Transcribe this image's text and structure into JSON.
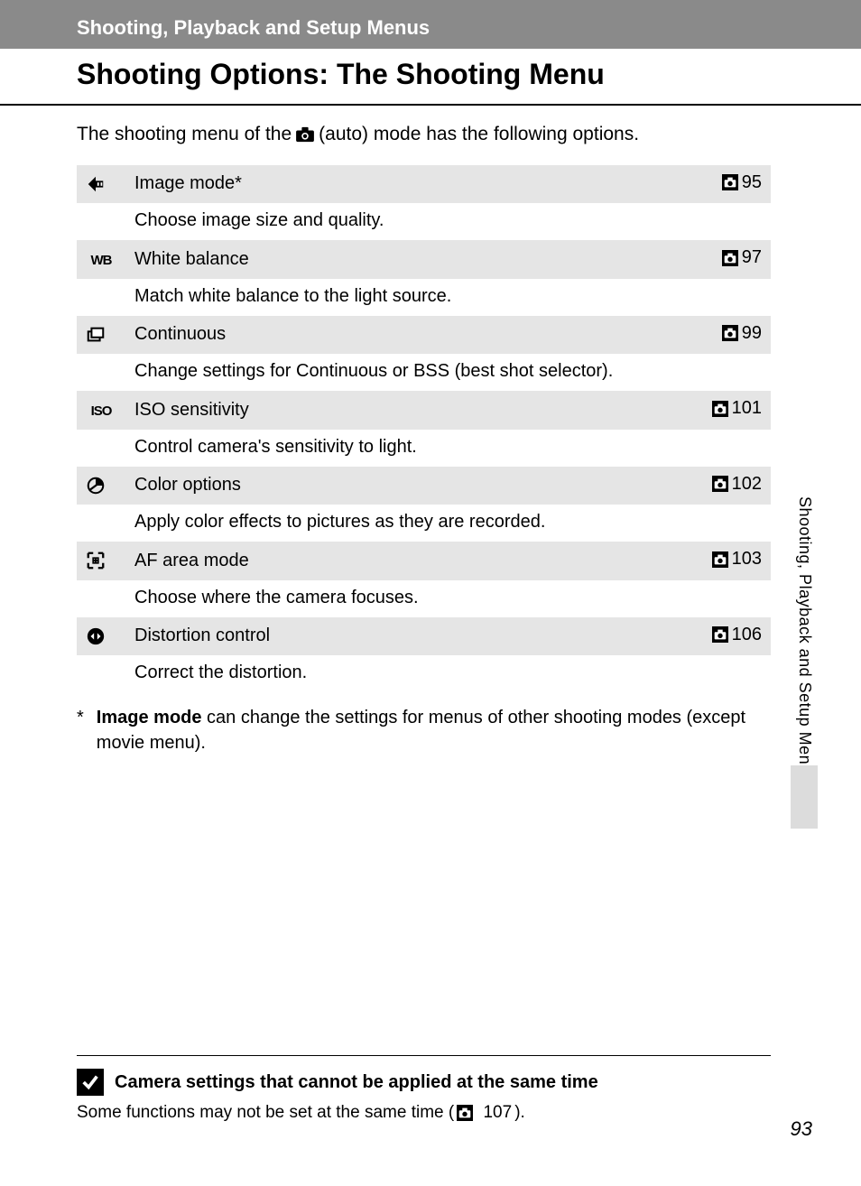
{
  "header": {
    "breadcrumb": "Shooting, Playback and Setup Menus",
    "title": "Shooting Options: The Shooting Menu"
  },
  "intro": {
    "before": "The shooting menu of the ",
    "after": " (auto) mode has the following options."
  },
  "options": [
    {
      "icon": "image-mode-icon",
      "label": "Image mode*",
      "page": "95",
      "desc": "Choose image size and quality."
    },
    {
      "icon": "wb-icon",
      "label": "White balance",
      "page": "97",
      "desc": "Match white balance to the light source."
    },
    {
      "icon": "continuous-icon",
      "label": "Continuous",
      "page": "99",
      "desc": "Change settings for Continuous or BSS (best shot selector)."
    },
    {
      "icon": "iso-icon",
      "label": "ISO sensitivity",
      "page": "101",
      "desc": "Control camera's sensitivity to light."
    },
    {
      "icon": "color-icon",
      "label": "Color options",
      "page": "102",
      "desc": "Apply color effects to pictures as they are recorded."
    },
    {
      "icon": "af-area-icon",
      "label": "AF area mode",
      "page": "103",
      "desc": "Choose where the camera focuses."
    },
    {
      "icon": "distortion-icon",
      "label": "Distortion control",
      "page": "106",
      "desc": "Correct the distortion."
    }
  ],
  "footnote": {
    "marker": "*",
    "bold": "Image mode",
    "rest": " can change the settings for menus of other shooting modes (except movie menu)."
  },
  "side_tab": "Shooting, Playback and Setup Menus",
  "note": {
    "title": "Camera settings that cannot be applied at the same time",
    "body_before": "Some functions may not be set at the same time (",
    "body_page": "107",
    "body_after": ")."
  },
  "page_number": "93"
}
